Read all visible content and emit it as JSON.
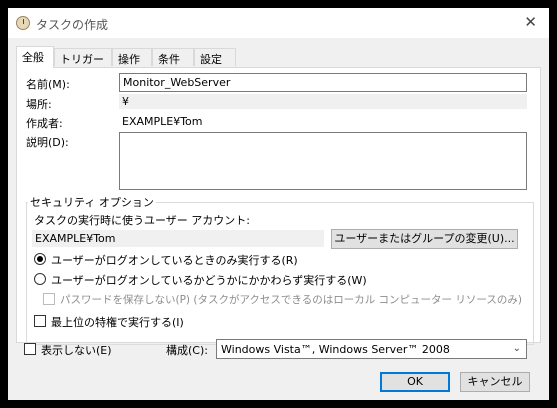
{
  "window": {
    "title": "タスクの作成",
    "close_glyph": "✕"
  },
  "tabs": [
    {
      "label": "全般",
      "active": true
    },
    {
      "label": "トリガー"
    },
    {
      "label": "操作"
    },
    {
      "label": "条件"
    },
    {
      "label": "設定"
    }
  ],
  "general": {
    "name_label": "名前(M):",
    "name_value": "Monitor_WebServer",
    "location_label": "場所:",
    "location_value": "¥",
    "author_label": "作成者:",
    "author_value": "EXAMPLE¥Tom",
    "description_label": "説明(D):",
    "description_value": ""
  },
  "security": {
    "group_title": "セキュリティ オプション",
    "account_label": "タスクの実行時に使うユーザー アカウント:",
    "account_value": "EXAMPLE¥Tom",
    "change_button": "ユーザーまたはグループの変更(U)...",
    "radio_logged_on": "ユーザーがログオンしているときのみ実行する(R)",
    "radio_whether": "ユーザーがログオンしているかどうかにかかわらず実行する(W)",
    "no_store_password": "パスワードを保存しない(P) (タスクがアクセスできるのはローカル コンピューター リソースのみ)",
    "highest_privileges": "最上位の特権で実行する(I)"
  },
  "footer": {
    "hidden_label": "表示しない(E)",
    "configure_label": "構成(C):",
    "configure_value": "Windows Vista™, Windows Server™ 2008",
    "ok_button": "OK",
    "cancel_button": "キャンセル"
  }
}
